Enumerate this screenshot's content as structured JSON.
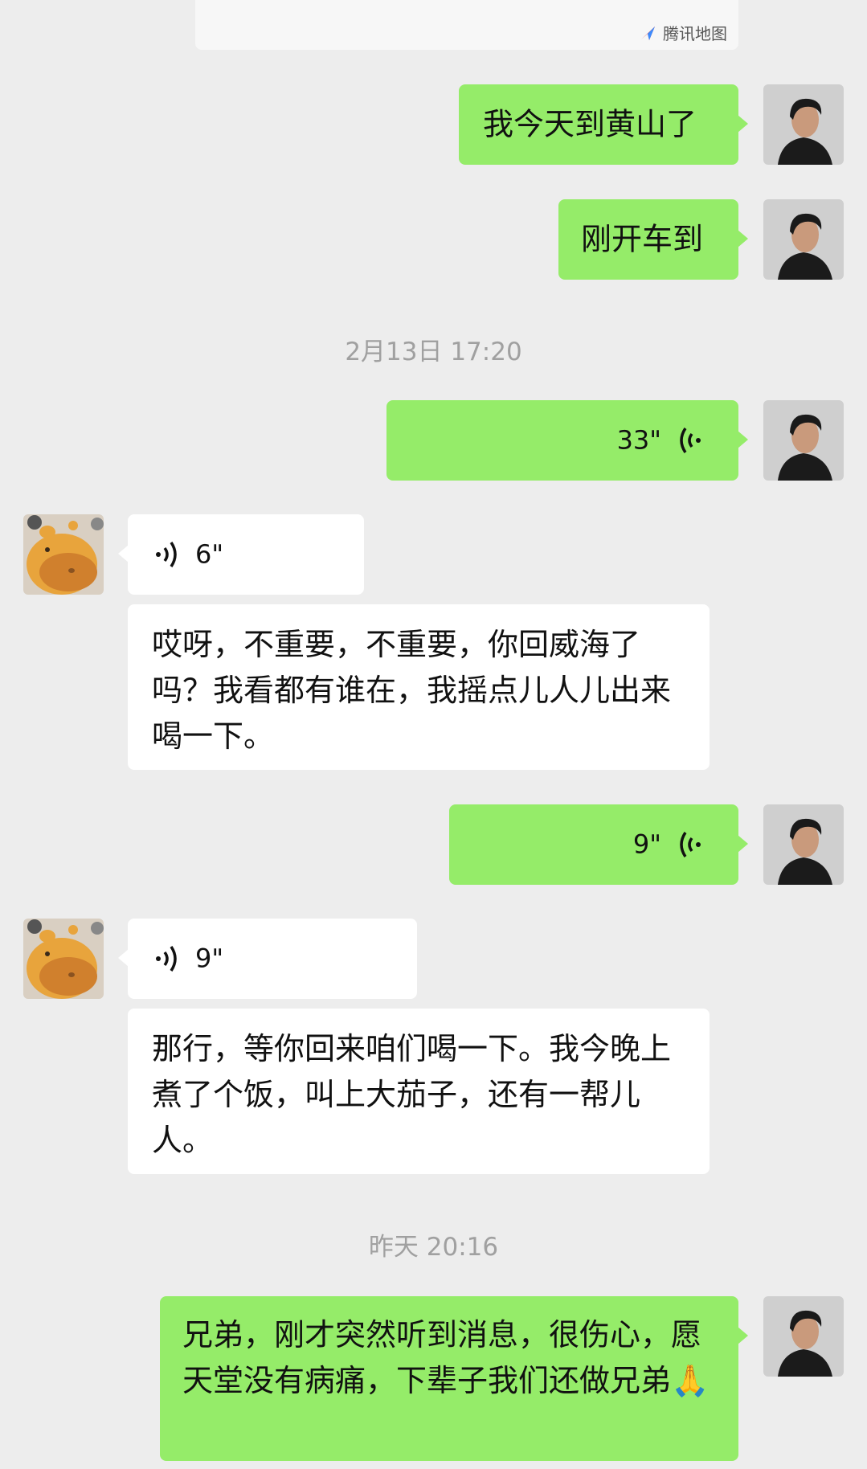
{
  "location_card": {
    "source": "腾讯地图",
    "logo_icon": "tencent-map-logo"
  },
  "messages": [
    {
      "text": "我今天到黄山了"
    },
    {
      "text": "刚开车到"
    },
    {
      "voice": "33\""
    },
    {
      "voice": "6\""
    },
    {
      "text": "哎呀，不重要，不重要，你回威海了吗？我看都有谁在，我摇点儿人儿出来喝一下。"
    },
    {
      "voice": "9\""
    },
    {
      "voice": "9\""
    },
    {
      "text": "那行，等你回来咱们喝一下。我今晚上煮了个饭，叫上大茄子，还有一帮儿人。"
    },
    {
      "text": "兄弟，刚才突然听到消息，很伤心，愿天堂没有病痛，下辈子我们还做兄弟🙏"
    }
  ],
  "timestamps": [
    "2月13日 17:20",
    "昨天 20:16"
  ],
  "colors": {
    "background": "#ededed",
    "my_bubble": "#95ec69",
    "their_bubble": "#ffffff",
    "timestamp": "#a0a0a0"
  }
}
